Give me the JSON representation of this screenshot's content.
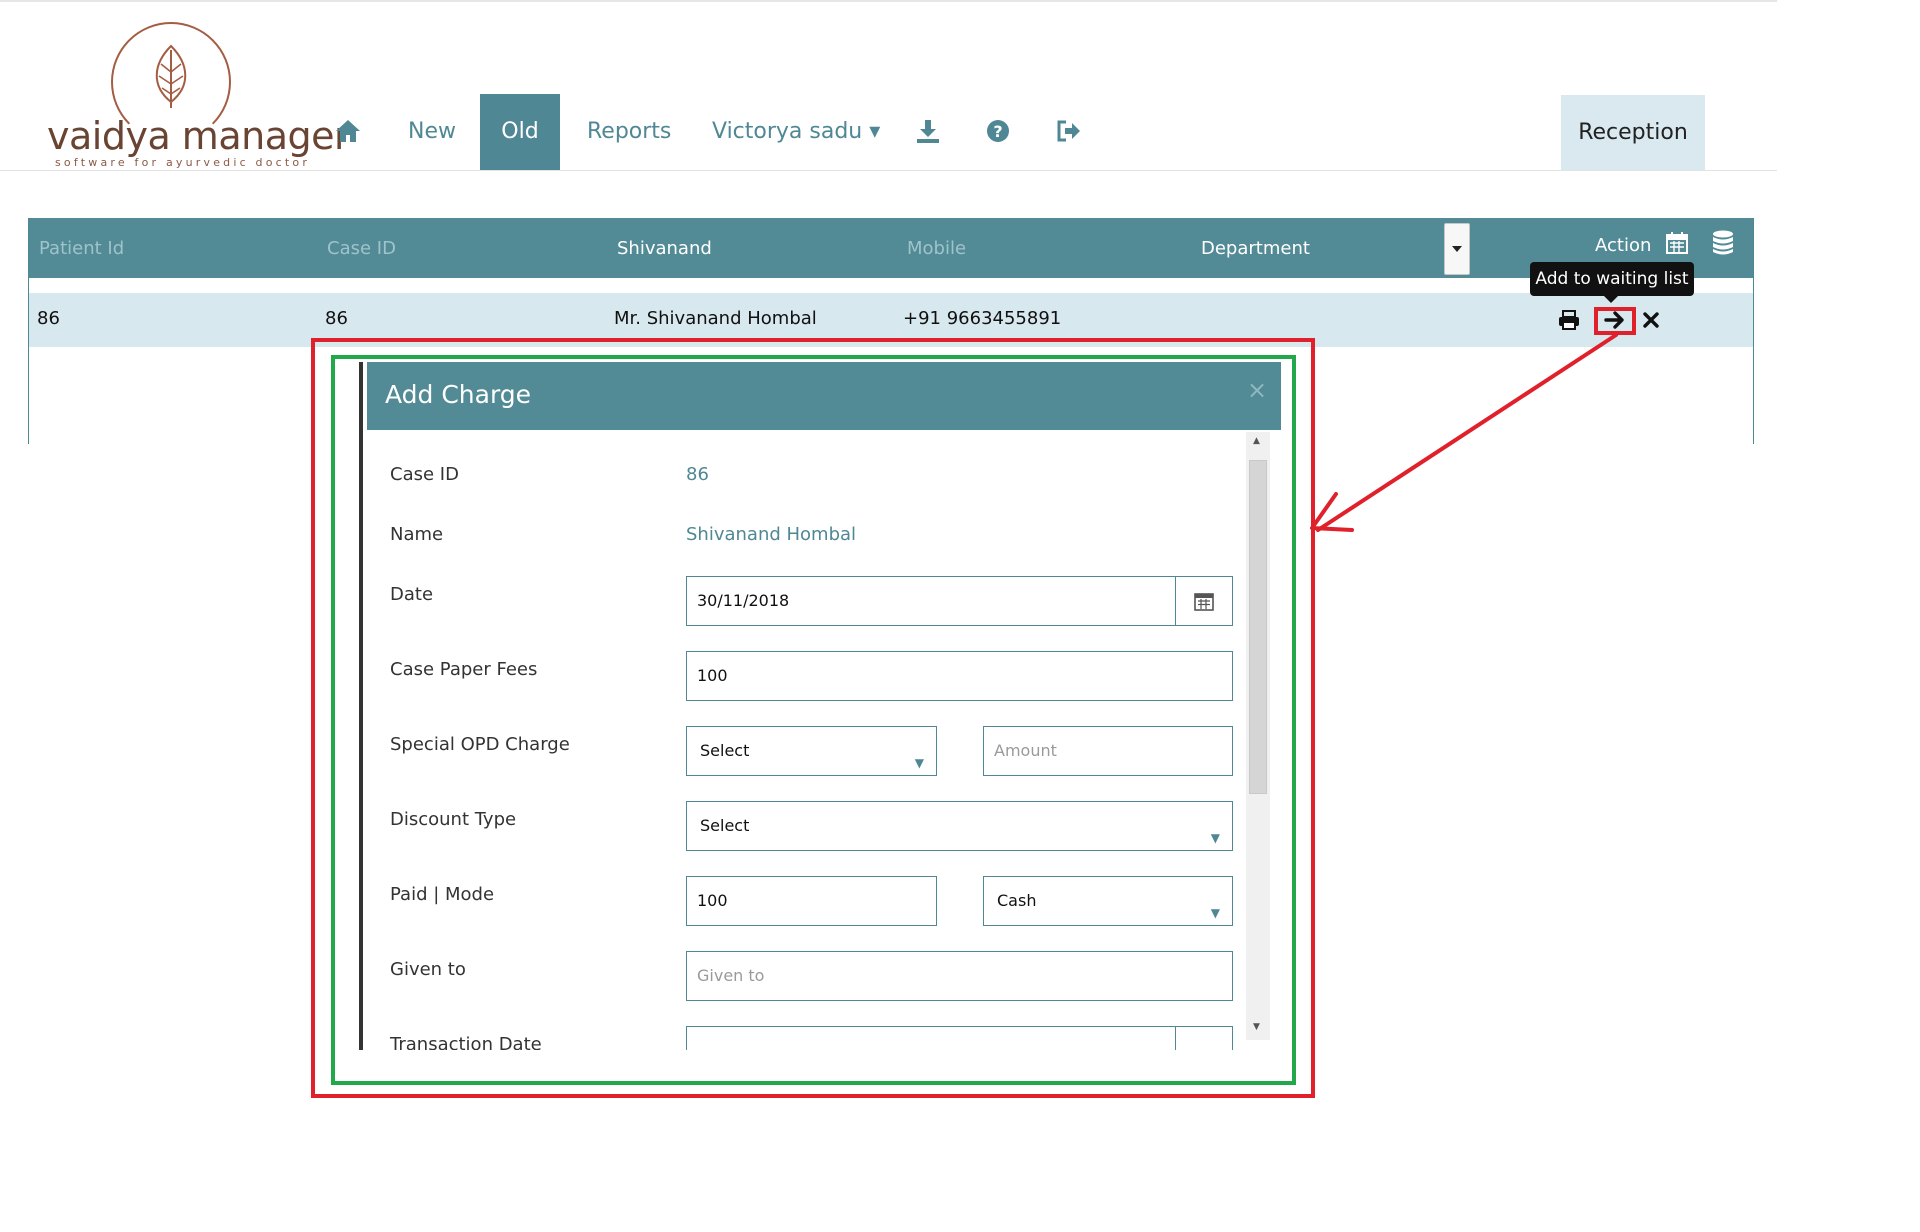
{
  "brand": {
    "name": "vaidya manager",
    "tagline": "software for ayurvedic doctor",
    "color": "#a45d43"
  },
  "nav": {
    "home_icon": "home-icon",
    "items": [
      {
        "label": "New"
      },
      {
        "label": "Old",
        "active": true
      },
      {
        "label": "Reports"
      },
      {
        "label": "Victorya sadu ▾"
      }
    ],
    "icons": [
      "download-icon",
      "help-icon",
      "logout-icon"
    ],
    "role": "Reception",
    "accent": "#4f8894"
  },
  "table": {
    "headers": [
      "Patient Id",
      "Case ID",
      "Shivanand",
      "Mobile",
      "Department",
      "Action"
    ],
    "header_icons": [
      "calendar-icon",
      "database-icon"
    ],
    "rows": [
      {
        "patient_id": "86",
        "case_id": "86",
        "name": "Mr. Shivanand Hombal",
        "mobile": "+91 9663455891"
      }
    ],
    "row_actions": [
      "print-icon",
      "arrow-right-icon",
      "close-icon"
    ],
    "tooltip": "Add to waiting list"
  },
  "modal": {
    "title": "Add Charge",
    "close": "×",
    "fields": {
      "case_id": {
        "label": "Case ID",
        "value": "86"
      },
      "name": {
        "label": "Name",
        "value": "Shivanand Hombal"
      },
      "date": {
        "label": "Date",
        "value": "30/11/2018"
      },
      "case_paper_fees": {
        "label": "Case Paper Fees",
        "value": "100"
      },
      "special_opd": {
        "label": "Special OPD Charge",
        "select": "Select",
        "amount_placeholder": "Amount"
      },
      "discount_type": {
        "label": "Discount Type",
        "select": "Select"
      },
      "paid_mode": {
        "label": "Paid | Mode",
        "paid": "100",
        "mode": "Cash"
      },
      "given_to": {
        "label": "Given to",
        "placeholder": "Given to"
      },
      "transaction_date": {
        "label": "Transaction Date"
      }
    }
  },
  "annotation_colors": {
    "outer": "#e0202b",
    "inner": "#22a84a"
  }
}
